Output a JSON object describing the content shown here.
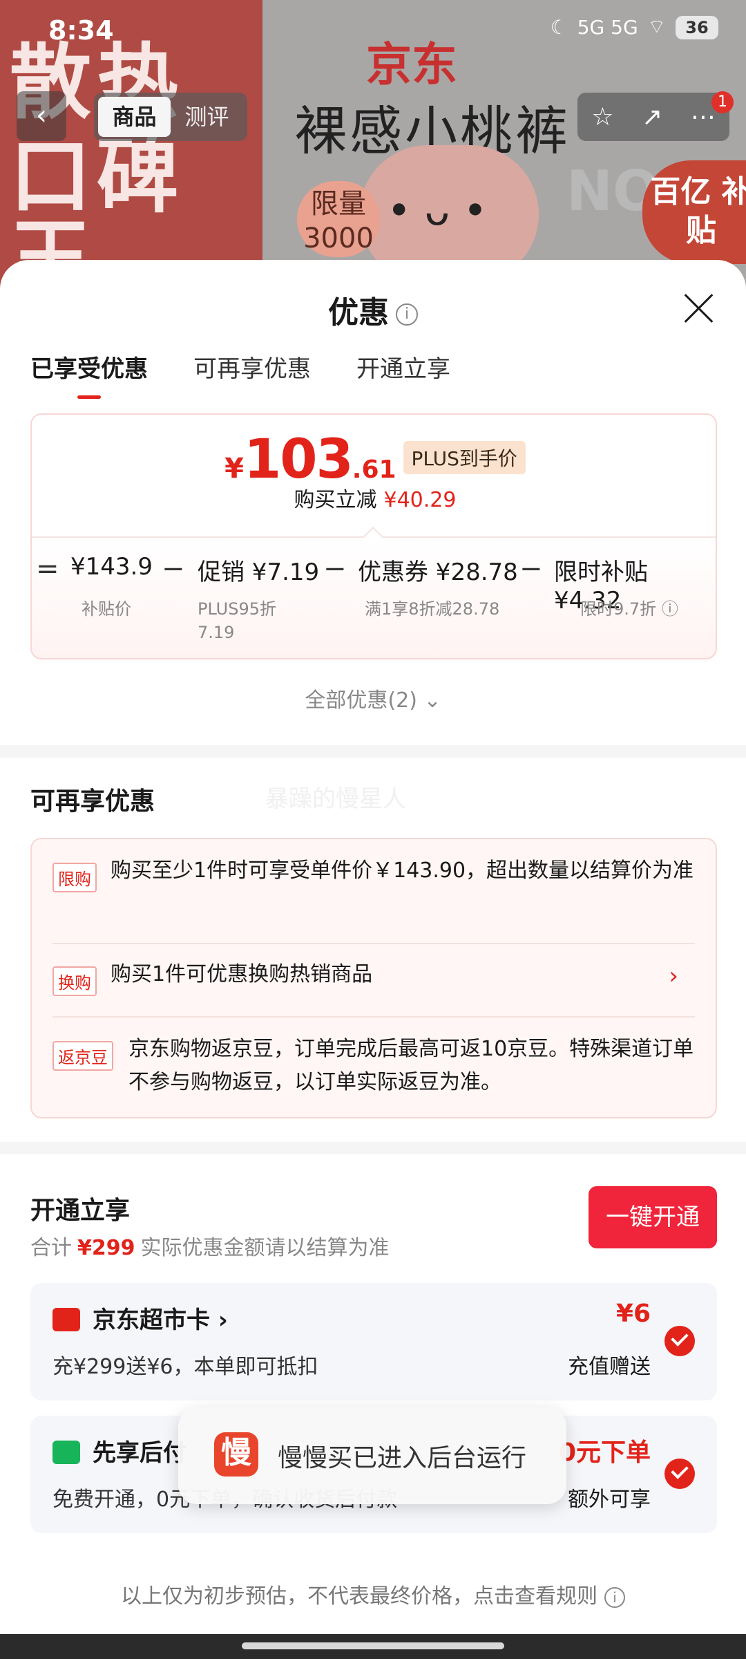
{
  "status_bar": {
    "time": "8:34",
    "network": "5G 5G",
    "battery": "36"
  },
  "background": {
    "left_banner": [
      "散热",
      "口碑王"
    ],
    "brand": "京东",
    "product_title": "裸感小桃裤",
    "limit": "限量 3000",
    "no_text": "NO",
    "badge": "百亿 补贴"
  },
  "top_nav": {
    "tabs": [
      "商品",
      "测评"
    ],
    "notification_count": "1"
  },
  "sheet": {
    "title": "优惠",
    "tabs": [
      "已享受优惠",
      "可再享优惠",
      "开通立享"
    ],
    "final_price": {
      "currency": "¥",
      "integer": "103",
      "decimal": ".61",
      "tag": "PLUS到手价"
    },
    "instant_discount_label": "购买立减",
    "instant_discount_value": "¥40.29",
    "breakdown": [
      {
        "op": "=",
        "value": "¥143.9",
        "note": "补贴价"
      },
      {
        "op": "−",
        "value": "促销 ¥7.19",
        "note": "PLUS95折 7.19"
      },
      {
        "op": "−",
        "value": "优惠券 ¥28.78",
        "note": "满1享8折减28.78"
      },
      {
        "op": "−",
        "value": "限时补贴 ¥4.32",
        "note": "限时9.7折"
      }
    ],
    "all_offers": "全部优惠(2)",
    "more_offers_title": "可再享优惠",
    "watermark": "暴躁的慢星人",
    "offers": [
      {
        "tag": "限购",
        "text": "购买至少1件时可享受单件价￥143.90，超出数量以结算价为准"
      },
      {
        "tag": "换购",
        "text": "购买1件可优惠换购热销商品"
      },
      {
        "tag": "返京豆",
        "text": "京东购物返京豆，订单完成后最高可返10京豆。特殊渠道订单不参与购物返豆，以订单实际返豆为准。"
      }
    ],
    "open_section": {
      "title": "开通立享",
      "total_label": "合计",
      "total_value": "¥299",
      "total_note": "实际优惠金额请以结算为准",
      "open_button": "一键开通",
      "services": [
        {
          "name": "京东超市卡 ›",
          "desc": "充¥299送¥6，本单即可抵扣",
          "amount": "¥6",
          "note": "充值赠送",
          "color": "#e2231a"
        },
        {
          "name": "先享后付",
          "desc": "免费开通，0元下单，确认收货后付款",
          "amount": "0元下单",
          "note": "额外可享",
          "color": "#18b45a"
        }
      ]
    },
    "footer_note": "以上仅为初步预估，不代表最终价格，点击查看规则"
  },
  "toast": {
    "icon_text": "慢",
    "message": "慢慢买已进入后台运行"
  }
}
